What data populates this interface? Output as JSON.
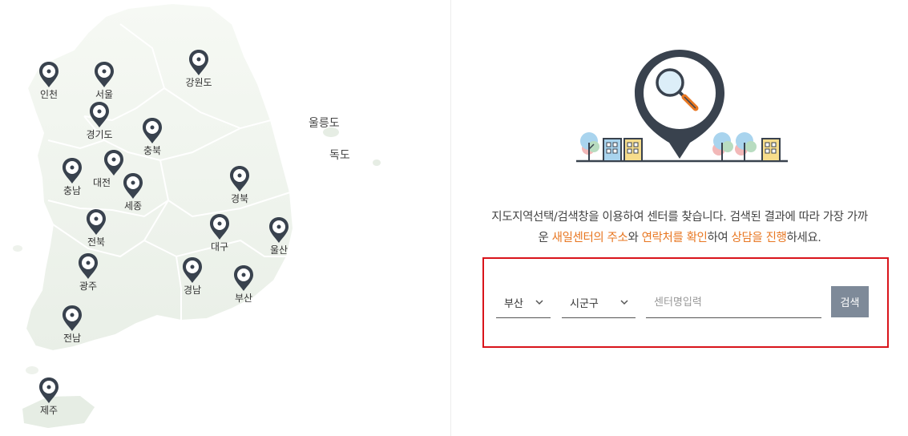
{
  "map": {
    "regions": [
      {
        "id": "incheon",
        "label": "인천"
      },
      {
        "id": "seoul",
        "label": "서울"
      },
      {
        "id": "gangwon",
        "label": "강원도"
      },
      {
        "id": "gyeonggi",
        "label": "경기도"
      },
      {
        "id": "chungbuk",
        "label": "충북"
      },
      {
        "id": "chungnam",
        "label": "충남"
      },
      {
        "id": "daejeon",
        "label": "대전"
      },
      {
        "id": "sejong",
        "label": "세종"
      },
      {
        "id": "gyeongbuk",
        "label": "경북"
      },
      {
        "id": "jeonbuk",
        "label": "전북"
      },
      {
        "id": "daegu",
        "label": "대구"
      },
      {
        "id": "ulsan",
        "label": "울산"
      },
      {
        "id": "gwangju",
        "label": "광주"
      },
      {
        "id": "gyeongnam",
        "label": "경남"
      },
      {
        "id": "busan",
        "label": "부산"
      },
      {
        "id": "jeonnam",
        "label": "전남"
      },
      {
        "id": "jeju",
        "label": "제주"
      }
    ],
    "islands": {
      "ulleungdo": "울릉도",
      "dokdo": "독도"
    },
    "pin_color": "#39424e",
    "land_color": "#eef2ec"
  },
  "info": {
    "desc_line1": "지도지역선택/검색창을 이용하여 센터를 찾습니다. 검색된 결과에 따라 가장 가까",
    "desc_line2_prefix": "운 ",
    "desc_line2_highlight1": "새일센터의 주소",
    "desc_line2_mid1": "와 ",
    "desc_line2_highlight2": "연락처를 확인",
    "desc_line2_mid2": "하여 ",
    "desc_line2_highlight3": "상담을 진행",
    "desc_line2_suffix": "하세요.",
    "highlight_color": "#e87722"
  },
  "search": {
    "region_value": "부산",
    "district_value": "시군구",
    "name_placeholder": "센터명입력",
    "button_label": "검색",
    "border_color": "#d9141b",
    "button_color": "#7e8a99"
  },
  "icons": {
    "map_pin": "map-pin-icon",
    "magnifier": "magnifier-icon",
    "chevron": "chevron-down-icon"
  }
}
